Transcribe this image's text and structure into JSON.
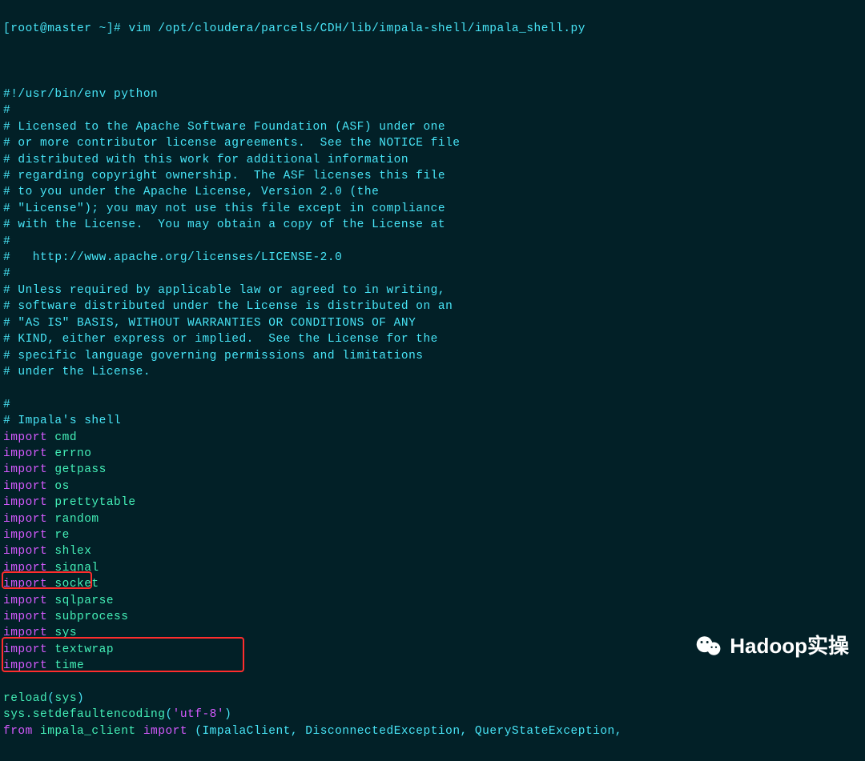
{
  "prompt": "[root@master ~]# ",
  "command": "vim /opt/cloudera/parcels/CDH/lib/impala-shell/impala_shell.py",
  "lines": [
    {
      "t": "comment",
      "v": "#!/usr/bin/env python"
    },
    {
      "t": "comment",
      "v": "#"
    },
    {
      "t": "comment",
      "v": "# Licensed to the Apache Software Foundation (ASF) under one"
    },
    {
      "t": "comment",
      "v": "# or more contributor license agreements.  See the NOTICE file"
    },
    {
      "t": "comment",
      "v": "# distributed with this work for additional information"
    },
    {
      "t": "comment",
      "v": "# regarding copyright ownership.  The ASF licenses this file"
    },
    {
      "t": "comment",
      "v": "# to you under the Apache License, Version 2.0 (the"
    },
    {
      "t": "comment",
      "v": "# \"License\"); you may not use this file except in compliance"
    },
    {
      "t": "comment",
      "v": "# with the License.  You may obtain a copy of the License at"
    },
    {
      "t": "comment",
      "v": "#"
    },
    {
      "t": "comment",
      "v": "#   http://www.apache.org/licenses/LICENSE-2.0"
    },
    {
      "t": "comment",
      "v": "#"
    },
    {
      "t": "comment",
      "v": "# Unless required by applicable law or agreed to in writing,"
    },
    {
      "t": "comment",
      "v": "# software distributed under the License is distributed on an"
    },
    {
      "t": "comment",
      "v": "# \"AS IS\" BASIS, WITHOUT WARRANTIES OR CONDITIONS OF ANY"
    },
    {
      "t": "comment",
      "v": "# KIND, either express or implied.  See the License for the"
    },
    {
      "t": "comment",
      "v": "# specific language governing permissions and limitations"
    },
    {
      "t": "comment",
      "v": "# under the License."
    },
    {
      "t": "blank",
      "v": ""
    },
    {
      "t": "comment",
      "v": "#"
    },
    {
      "t": "comment",
      "v": "# Impala's shell"
    },
    {
      "t": "import",
      "kw": "import",
      "mod": "cmd"
    },
    {
      "t": "import",
      "kw": "import",
      "mod": "errno"
    },
    {
      "t": "import",
      "kw": "import",
      "mod": "getpass"
    },
    {
      "t": "import",
      "kw": "import",
      "mod": "os"
    },
    {
      "t": "import",
      "kw": "import",
      "mod": "prettytable"
    },
    {
      "t": "import",
      "kw": "import",
      "mod": "random"
    },
    {
      "t": "import",
      "kw": "import",
      "mod": "re"
    },
    {
      "t": "import",
      "kw": "import",
      "mod": "shlex"
    },
    {
      "t": "import",
      "kw": "import",
      "mod": "signal"
    },
    {
      "t": "import",
      "kw": "import",
      "mod": "socket"
    },
    {
      "t": "import",
      "kw": "import",
      "mod": "sqlparse"
    },
    {
      "t": "import",
      "kw": "import",
      "mod": "subprocess"
    },
    {
      "t": "import",
      "kw": "import",
      "mod": "sys"
    },
    {
      "t": "import",
      "kw": "import",
      "mod": "textwrap"
    },
    {
      "t": "import",
      "kw": "import",
      "mod": "time"
    },
    {
      "t": "blank",
      "v": ""
    },
    {
      "t": "reload",
      "fn": "reload",
      "arg": "sys"
    },
    {
      "t": "setenc",
      "obj": "sys.setdefaultencoding",
      "str": "'utf-8'"
    },
    {
      "t": "fromimport",
      "kw1": "from",
      "mod": "impala_client",
      "kw2": "import",
      "rest": "(ImpalaClient, DisconnectedException, QueryStateException,"
    }
  ],
  "watermark": "Hadoop实操"
}
